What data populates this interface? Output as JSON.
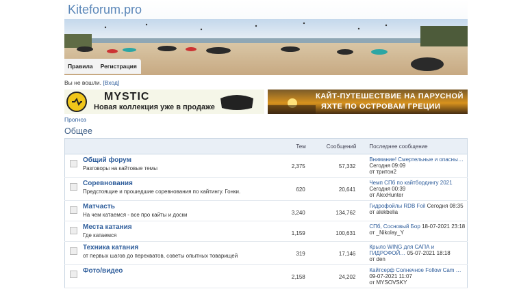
{
  "header": {
    "site_title": "Kiteforum.pro",
    "nav": [
      {
        "label": "Правила"
      },
      {
        "label": "Регистрация"
      }
    ]
  },
  "status": {
    "text": "Вы не вошли.",
    "login_link": "[Вход]"
  },
  "ads": [
    {
      "brand": "MYSTIC",
      "text": "Новая коллекция уже в продаже"
    },
    {
      "line1": "КАЙТ-ПУТЕШЕСТВИЕ НА ПАРУСНОЙ",
      "line2": "ЯХТЕ ПО ОСТРОВАМ ГРЕЦИИ"
    }
  ],
  "breadcrumb": "Прогноз",
  "section_title": "Общее",
  "table": {
    "headers": {
      "topics": "Тем",
      "messages": "Сообщений",
      "last_post": "Последнее сообщение"
    },
    "rows": [
      {
        "name": "Общий форум",
        "desc": "Разговоры на кайтовые темы",
        "topics": "2,375",
        "messages": "57,332",
        "last_link": "Внимание! Смертельные и опасны…",
        "last_time": "Сегодня 09:09",
        "last_by": "от тритон2"
      },
      {
        "name": "Соревнования",
        "desc": "Предстоящие и прошедшие соревнования по кайтингу. Гонки.",
        "topics": "620",
        "messages": "20,641",
        "last_link": "Чемп СПб по кайтбордингу 2021",
        "last_time": "Сегодня 00:39",
        "last_by": "от AlexHunter"
      },
      {
        "name": "Матчасть",
        "desc": "На чем катаемся - все про кайты и доски",
        "topics": "3,240",
        "messages": "134,762",
        "last_link": "Гидрофойлы RDB Foil",
        "last_time": "Сегодня 08:35",
        "last_by": "от alekbelia"
      },
      {
        "name": "Места катания",
        "desc": "Где катаемся",
        "topics": "1,159",
        "messages": "100,631",
        "last_link": "СПб, Сосновый Бор",
        "last_time": "18-07-2021 23:18",
        "last_by": "от _Nikolay_Y"
      },
      {
        "name": "Техника катания",
        "desc": "от первых шагов до перехватов, советы опытных товарищей",
        "topics": "319",
        "messages": "17,146",
        "last_link": "Крыло WING для САПА и ГИДРОФОЙ…",
        "last_time": "05-07-2021 18:18",
        "last_by": "от den"
      },
      {
        "name": "Фото/видео",
        "desc": "",
        "topics": "2,158",
        "messages": "24,202",
        "last_link": "Кайтсерф Солнечное Follow Cam …",
        "last_time": "09-07-2021 11:07",
        "last_by": "от MYSOVSKY"
      }
    ]
  }
}
